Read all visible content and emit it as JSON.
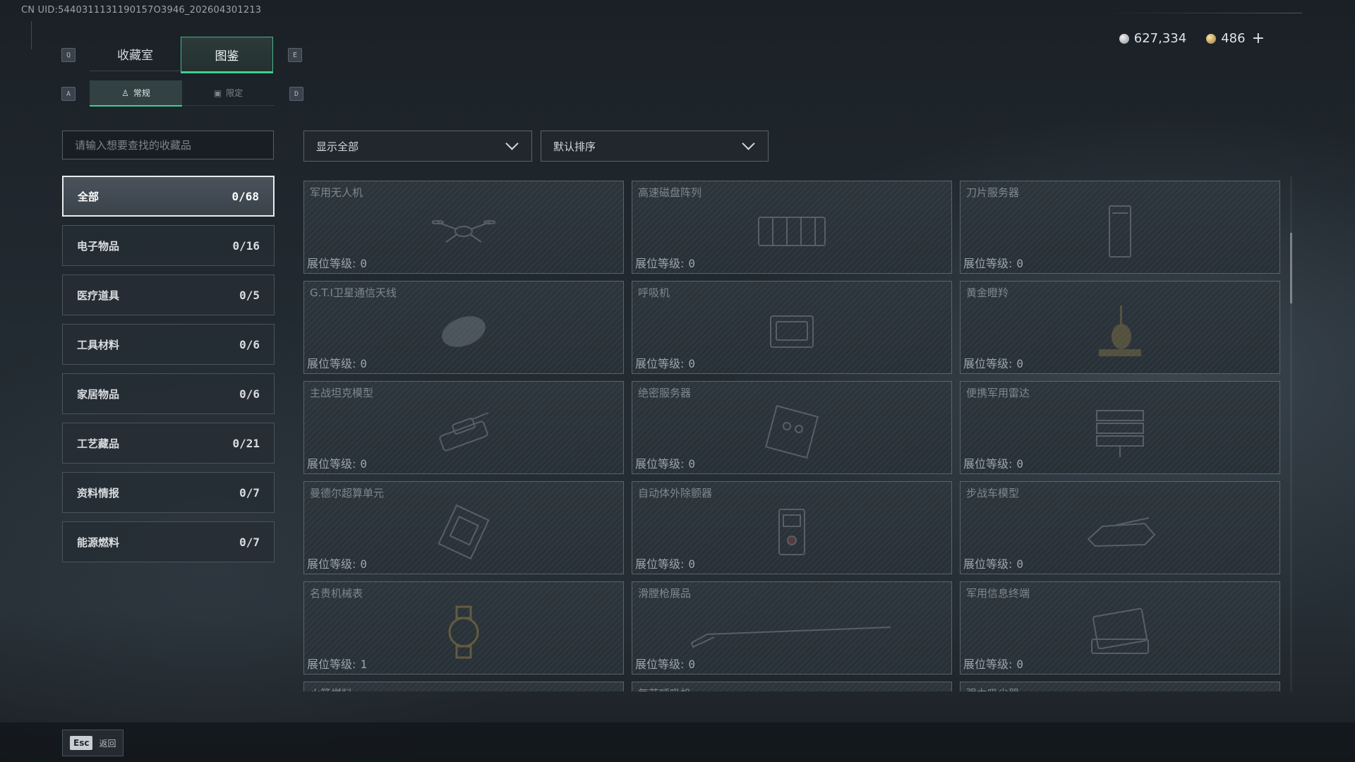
{
  "uid": "CN UID:5440311131190157O3946_202604301213",
  "currency": {
    "silver": "627,334",
    "gold": "486",
    "plus": "+"
  },
  "keys": {
    "prev_tab": "Q",
    "next_tab": "E",
    "prev_sub": "A",
    "next_sub": "D",
    "esc": "Esc"
  },
  "main_tabs": [
    {
      "label": "收藏室",
      "active": false
    },
    {
      "label": "图鉴",
      "active": true
    }
  ],
  "sub_tabs": [
    {
      "label": "常规",
      "icon": "figure-icon",
      "active": true
    },
    {
      "label": "限定",
      "icon": "box-icon",
      "active": false
    }
  ],
  "search": {
    "placeholder": "请输入想要查找的收藏品"
  },
  "categories": [
    {
      "label": "全部",
      "count": "0/68",
      "active": true
    },
    {
      "label": "电子物品",
      "count": "0/16"
    },
    {
      "label": "医疗道具",
      "count": "0/5"
    },
    {
      "label": "工具材料",
      "count": "0/6"
    },
    {
      "label": "家居物品",
      "count": "0/6"
    },
    {
      "label": "工艺藏品",
      "count": "0/21"
    },
    {
      "label": "资料情报",
      "count": "0/7"
    },
    {
      "label": "能源燃料",
      "count": "0/7"
    }
  ],
  "filter": {
    "value": "显示全部"
  },
  "sort": {
    "value": "默认排序"
  },
  "level_label": "展位等级:",
  "items": [
    {
      "name": "军用无人机",
      "level": "0",
      "icon": "drone-icon"
    },
    {
      "name": "高速磁盘阵列",
      "level": "0",
      "icon": "disk-array-icon"
    },
    {
      "name": "刀片服务器",
      "level": "0",
      "icon": "blade-server-icon"
    },
    {
      "name": "G.T.I卫星通信天线",
      "level": "0",
      "icon": "satellite-dish-icon"
    },
    {
      "name": "呼吸机",
      "level": "0",
      "icon": "ventilator-icon"
    },
    {
      "name": "黄金瞪羚",
      "level": "0",
      "icon": "gazelle-statue-icon"
    },
    {
      "name": "主战坦克模型",
      "level": "0",
      "icon": "tank-model-icon"
    },
    {
      "name": "绝密服务器",
      "level": "0",
      "icon": "server-icon"
    },
    {
      "name": "便携军用雷达",
      "level": "0",
      "icon": "radar-icon"
    },
    {
      "name": "曼德尔超算单元",
      "level": "0",
      "icon": "supercomputer-icon"
    },
    {
      "name": "自动体外除颤器",
      "level": "0",
      "icon": "defibrillator-icon"
    },
    {
      "name": "步战车模型",
      "level": "0",
      "icon": "ifv-model-icon"
    },
    {
      "name": "名贵机械表",
      "level": "1",
      "icon": "watch-icon"
    },
    {
      "name": "滑膛枪展品",
      "level": "0",
      "icon": "musket-icon"
    },
    {
      "name": "军用信息终端",
      "level": "0",
      "icon": "terminal-icon"
    },
    {
      "name": "火箭燃料",
      "level": "",
      "icon": ""
    },
    {
      "name": "复苏呼吸机",
      "level": "",
      "icon": ""
    },
    {
      "name": "强力吸尘器",
      "level": "",
      "icon": ""
    }
  ],
  "back": {
    "label": "返回"
  }
}
